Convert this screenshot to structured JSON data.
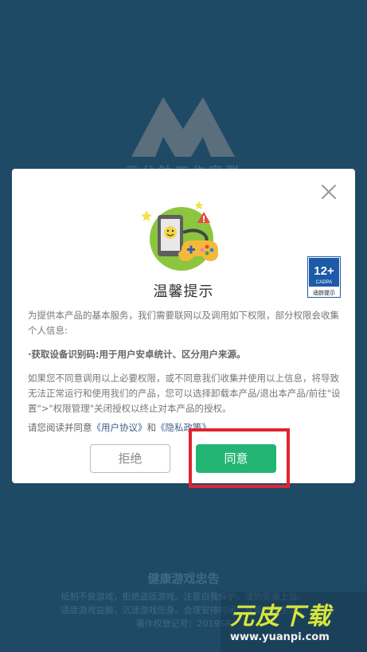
{
  "background": {
    "brand": "云分钟工作室群",
    "notice_title": "健康游戏忠告",
    "notice_lines": [
      "抵制不良游戏，拒绝盗版游戏。注意自我保护，谨防受骗上当。",
      "适度游戏益脑，沉迷游戏伤身。合理安排时间，享受健康生活。",
      "著作权登记号：2019SR"
    ]
  },
  "dialog": {
    "title": "温馨提示",
    "age_rating": {
      "number": "12+",
      "org": "CADPA",
      "label": "适龄提示"
    },
    "paragraphs": {
      "intro": "为提供本产品的基本服务，我们需要联网以及调用如下权限，部分权限会收集个人信息:",
      "permission": "·获取设备识别码:用于用户安卓统计、区分用户来源。",
      "refuse_note": "如果您不同意调用以上必要权限，或不同意我们收集并使用以上信息，将导致无法正常运行和使用我们的产品，您可以选择卸载本产品/退出本产品/前往\"设置\">\"权限管理\"关闭授权以终止对本产品的授权。"
    },
    "agree_prefix": "请您阅读并同意",
    "user_agreement": "《用户协议》",
    "and": "和",
    "privacy_policy": "《隐私政策》",
    "reject_label": "拒绝",
    "agree_label": "同意"
  },
  "watermark": {
    "logo": "元皮下载",
    "url": "www.yuanpi.com"
  },
  "colors": {
    "background": "#1f4a66",
    "agree_green": "#22b573",
    "highlight_red": "#e0242e",
    "link": "#3f5f8a"
  }
}
